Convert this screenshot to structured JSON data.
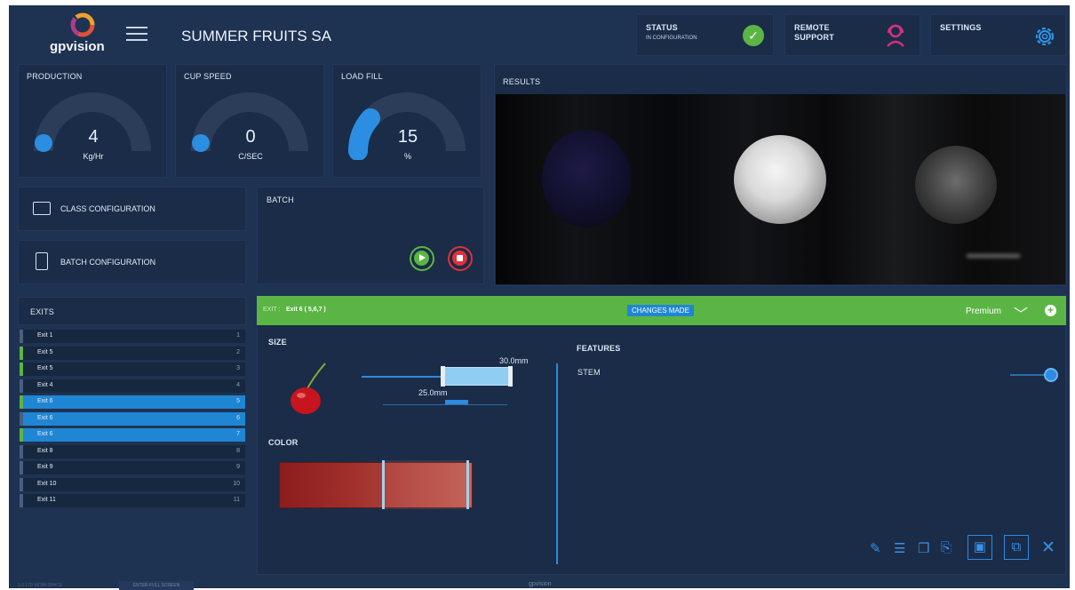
{
  "header": {
    "logo_text": "gpvision",
    "title": "SUMMER FRUITS SA",
    "status": {
      "label": "STATUS",
      "value": "IN CONFIGURATION"
    },
    "remote_support": {
      "label": "REMOTE SUPPORT"
    },
    "settings": {
      "label": "SETTINGS"
    }
  },
  "gauges": [
    {
      "label": "PRODUCTION",
      "value": "4",
      "unit": "Kg/Hr",
      "fill": 0.02
    },
    {
      "label": "CUP SPEED",
      "value": "0",
      "unit": "C/SEC",
      "fill": 0.0
    },
    {
      "label": "LOAD FILL",
      "value": "15",
      "unit": "%",
      "fill": 0.15
    }
  ],
  "buttons": {
    "class_config": "CLASS CONFIGURATION",
    "batch_config": "BATCH CONFIGURATION"
  },
  "batch": {
    "label": "BATCH"
  },
  "results": {
    "label": "RESULTS"
  },
  "exits": {
    "label": "EXITS",
    "items": [
      {
        "name": "Exit 1",
        "num": "1",
        "mark": "none",
        "selected": false
      },
      {
        "name": "Exit 5",
        "num": "2",
        "mark": "green",
        "selected": false
      },
      {
        "name": "Exit 5",
        "num": "3",
        "mark": "green",
        "selected": false
      },
      {
        "name": "Exit 4",
        "num": "4",
        "mark": "none",
        "selected": false
      },
      {
        "name": "Exit 6",
        "num": "5",
        "mark": "green",
        "selected": true
      },
      {
        "name": "Exit 6",
        "num": "6",
        "mark": "none",
        "selected": true
      },
      {
        "name": "Exit 6",
        "num": "7",
        "mark": "green",
        "selected": true
      },
      {
        "name": "Exit 8",
        "num": "8",
        "mark": "none",
        "selected": false
      },
      {
        "name": "Exit 9",
        "num": "9",
        "mark": "none",
        "selected": false
      },
      {
        "name": "Exit 10",
        "num": "10",
        "mark": "none",
        "selected": false
      },
      {
        "name": "Exit 11",
        "num": "11",
        "mark": "none",
        "selected": false
      }
    ]
  },
  "exit_panel": {
    "prefix": "EXIT :",
    "title": "Exit 6 ( 5,6,7 )",
    "changes_badge": "CHANGES MADE",
    "grade": "Premium",
    "size_label": "SIZE",
    "size_max": "30.0mm",
    "size_min": "25.0mm",
    "color_label": "COLOR",
    "features_label": "FEATURES",
    "feature_stem": "STEM"
  },
  "footer": {
    "left_text": "1.6.170 WORKSPACE",
    "fullscreen_button": "ENTER FULL SCREEN",
    "center_text": "gpvision"
  },
  "colors": {
    "accent_green": "#5bb544",
    "accent_blue": "#1f86d4",
    "background": "#1e3251",
    "card": "#1a2c48",
    "stop_red": "#e0303a"
  }
}
